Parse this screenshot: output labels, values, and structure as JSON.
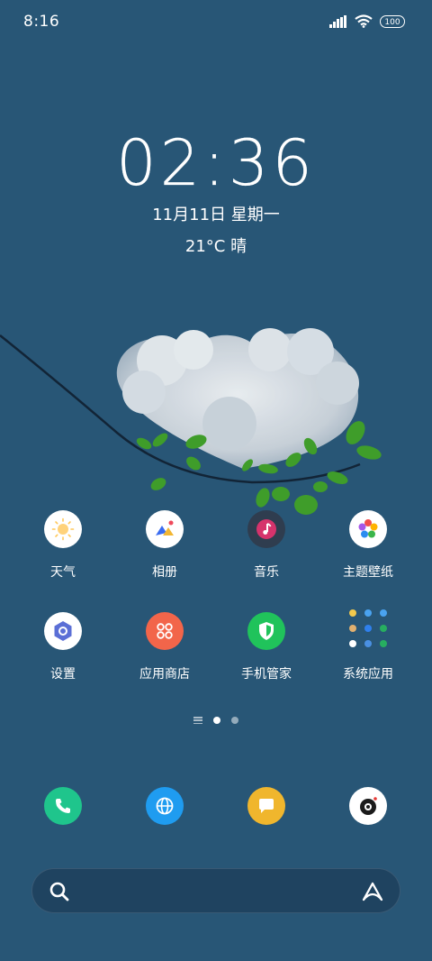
{
  "status": {
    "time": "8:16",
    "battery": "100"
  },
  "lockclock": {
    "time": "02:36",
    "date": "11月11日  星期一",
    "weather": "21°C 晴"
  },
  "apps": [
    {
      "label": "天气",
      "icon": "weather-sun-icon"
    },
    {
      "label": "相册",
      "icon": "gallery-icon"
    },
    {
      "label": "音乐",
      "icon": "music-note-icon"
    },
    {
      "label": "主题壁纸",
      "icon": "theme-flower-icon"
    },
    {
      "label": "设置",
      "icon": "settings-hexagon-icon"
    },
    {
      "label": "应用商店",
      "icon": "app-store-icon"
    },
    {
      "label": "手机管家",
      "icon": "security-shield-icon"
    },
    {
      "label": "系统应用",
      "icon": "system-apps-folder-icon"
    }
  ],
  "dock": [
    {
      "name": "phone",
      "icon": "phone-icon",
      "color": "#1fc58c"
    },
    {
      "name": "browser",
      "icon": "globe-icon",
      "color": "#1f9cf0"
    },
    {
      "name": "messages",
      "icon": "message-bubble-icon",
      "color": "#f0b62d"
    },
    {
      "name": "camera",
      "icon": "camera-lens-icon",
      "color": "#ffffff"
    }
  ],
  "pager": {
    "pages": 2,
    "current": 1
  }
}
